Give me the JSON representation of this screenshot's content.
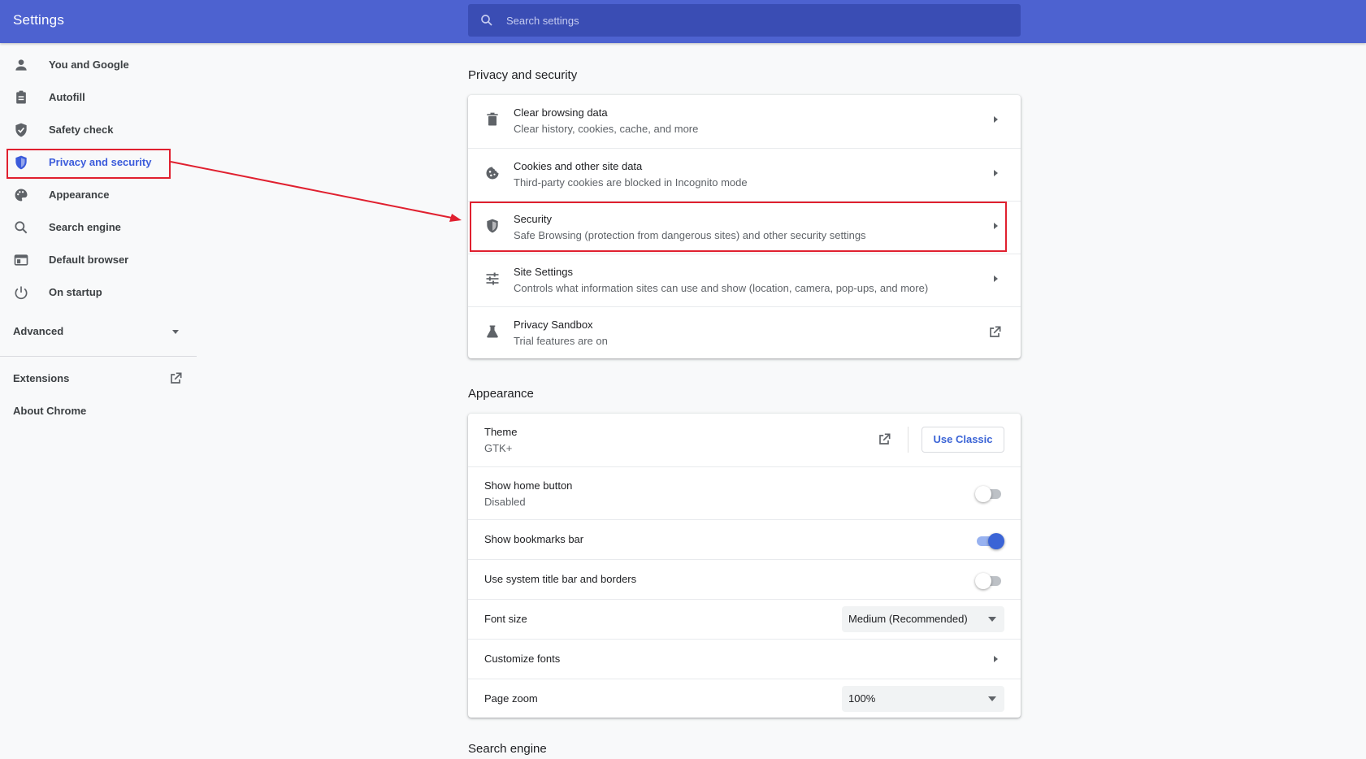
{
  "header": {
    "title": "Settings",
    "search_placeholder": "Search settings"
  },
  "sidebar": {
    "items": [
      {
        "label": "You and Google",
        "icon": "person-icon"
      },
      {
        "label": "Autofill",
        "icon": "clipboard-icon"
      },
      {
        "label": "Safety check",
        "icon": "shield-check-icon"
      },
      {
        "label": "Privacy and security",
        "icon": "shield-icon",
        "active": true
      },
      {
        "label": "Appearance",
        "icon": "palette-icon"
      },
      {
        "label": "Search engine",
        "icon": "search-icon"
      },
      {
        "label": "Default browser",
        "icon": "browser-icon"
      },
      {
        "label": "On startup",
        "icon": "power-icon"
      }
    ],
    "advanced_label": "Advanced",
    "extensions_label": "Extensions",
    "about_label": "About Chrome"
  },
  "privacy": {
    "title": "Privacy and security",
    "rows": [
      {
        "primary": "Clear browsing data",
        "secondary": "Clear history, cookies, cache, and more",
        "icon": "trash-icon"
      },
      {
        "primary": "Cookies and other site data",
        "secondary": "Third-party cookies are blocked in Incognito mode",
        "icon": "cookie-icon"
      },
      {
        "primary": "Security",
        "secondary": "Safe Browsing (protection from dangerous sites) and other security settings",
        "icon": "shield-icon"
      },
      {
        "primary": "Site Settings",
        "secondary": "Controls what information sites can use and show (location, camera, pop-ups, and more)",
        "icon": "sliders-icon"
      },
      {
        "primary": "Privacy Sandbox",
        "secondary": "Trial features are on",
        "icon": "flask-icon"
      }
    ]
  },
  "appearance": {
    "title": "Appearance",
    "theme": {
      "primary": "Theme",
      "secondary": "GTK+",
      "button": "Use Classic"
    },
    "home_button": {
      "primary": "Show home button",
      "secondary": "Disabled",
      "enabled": false
    },
    "bookmarks_bar": {
      "primary": "Show bookmarks bar",
      "enabled": true
    },
    "system_title_bar": {
      "primary": "Use system title bar and borders",
      "enabled": false
    },
    "font_size": {
      "primary": "Font size",
      "value": "Medium (Recommended)"
    },
    "customize_fonts": {
      "primary": "Customize fonts"
    },
    "page_zoom": {
      "primary": "Page zoom",
      "value": "100%"
    }
  },
  "search_engine": {
    "title": "Search engine"
  },
  "colors": {
    "header": "#4d62d0",
    "accent": "#3b64d6",
    "highlight": "#e0202f"
  }
}
